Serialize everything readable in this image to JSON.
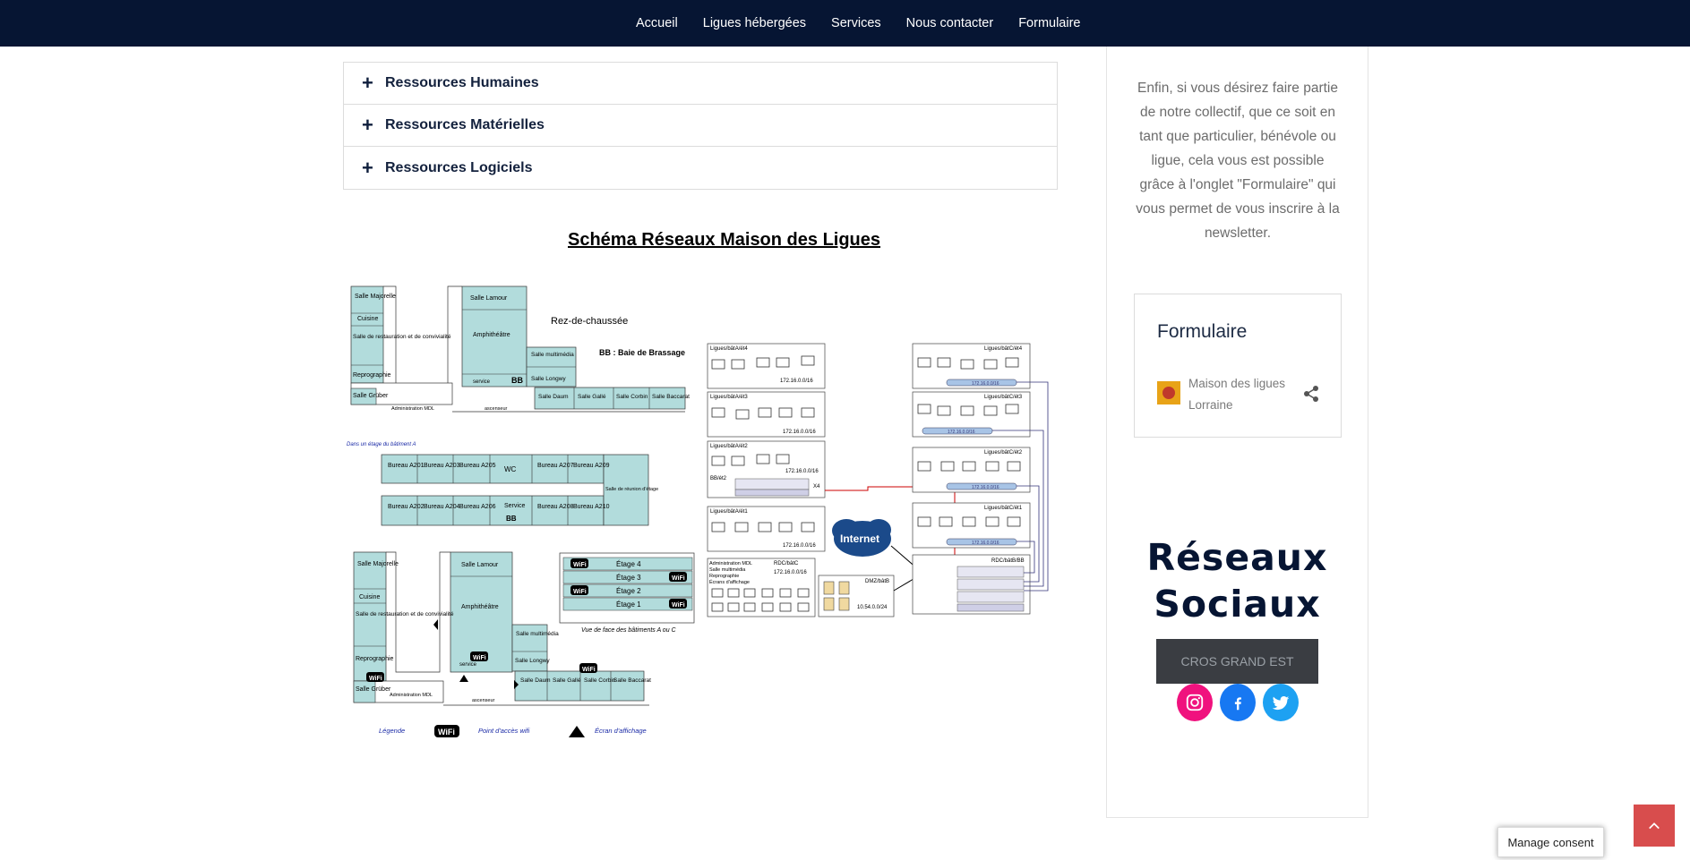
{
  "nav": {
    "items": [
      "Accueil",
      "Ligues hébergées",
      "Services",
      "Nous contacter",
      "Formulaire"
    ]
  },
  "accordion": {
    "items": [
      "Ressources Humaines",
      "Ressources Matérielles",
      "Ressources Logiciels"
    ]
  },
  "schema": {
    "title": "Schéma Réseaux Maison des Ligues",
    "floor_label": "Rez-de-chaussée",
    "bb_legend": "BB : Baie de Brassage",
    "upper_floor_note": "Dans un étage du bâtiment A",
    "rooms_ground": [
      "Salle Majorelle",
      "Cuisine",
      "Salle de restauration et de convivialité",
      "Reprographie",
      "Salle Grüber",
      "Administration MDL",
      "Salle Lamour",
      "Amphithéâtre",
      "service",
      "BB",
      "Salle multimédia",
      "Salle Longwy",
      "Salle Daum",
      "Salle Gallé",
      "Salle Corbin",
      "Salle Baccarat",
      "ascenseur"
    ],
    "offices": [
      "Bureau A201",
      "Bureau A203",
      "Bureau A205",
      "WC",
      "Bureau A207",
      "Bureau A209",
      "Bureau A202",
      "Bureau A204",
      "Bureau A206",
      "Service",
      "BB",
      "Bureau A208",
      "Bureau A210",
      "Salle de réunion d'étage"
    ],
    "floors": [
      "Étage 4",
      "Étage 3",
      "Étage 2",
      "Étage 1"
    ],
    "facade_caption": "Vue de face des bâtiments A ou C",
    "legend": {
      "title": "Légende",
      "wifi": "Point d'accès wifi",
      "screen": "Écran d'affichage"
    },
    "network_a": [
      {
        "label": "Ligues/bâtA/ét4",
        "ip": "172.16.0.0/16"
      },
      {
        "label": "Ligues/bâtA/ét3",
        "ip": "172.16.0.0/16"
      },
      {
        "label": "Ligues/bâtA/ét2",
        "ip": "172.16.0.0/16"
      },
      {
        "label": "Ligues/bâtA/ét1",
        "ip": "172.16.0.0/16"
      }
    ],
    "network_c": [
      {
        "label": "Ligues/bâtC/ét4",
        "ip": "172.16.0.0/16"
      },
      {
        "label": "Ligues/bâtC/ét3",
        "ip": "172.16.0.0/16"
      },
      {
        "label": "Ligues/bâtC/ét2",
        "ip": "172.16.0.0/16"
      },
      {
        "label": "Ligues/bâtC/ét1",
        "ip": "172.16.0.0/16"
      }
    ],
    "rdc": {
      "label": "RDC/bâtC",
      "ip": "172.16.0.0/16",
      "lines": [
        "Administration MDL",
        "Salle multimédia",
        "Reprographie",
        "Écrans d'affichage"
      ]
    },
    "dmz": {
      "label": "DMZ/bâtB",
      "ip": "10.54.0.0/24"
    },
    "bb_label": "BB/ét2",
    "x4": "X4",
    "internet": "Internet",
    "rdc_bb": "RDC/bâtB/BB"
  },
  "sidebar": {
    "text": "Enfin, si vous désirez faire partie de notre collectif, que ce soit en tant que particulier, bénévole ou ligue, cela vous est possible grâce à l'onglet \"Formulaire\" qui vous permet de vous inscrire à la newsletter.",
    "form_card": {
      "title": "Formulaire",
      "org": "Maison des ligues Lorraine"
    },
    "brand_line1": "Réseaux",
    "brand_line2": "Sociaux",
    "cros_button": "CROS GRAND EST",
    "social": [
      {
        "name": "instagram",
        "color": "#f0127e"
      },
      {
        "name": "facebook",
        "color": "#1778f2"
      },
      {
        "name": "twitter",
        "color": "#1da1f2"
      }
    ]
  },
  "consent": {
    "label": "Manage consent"
  },
  "colors": {
    "nav_bg": "#061533",
    "brand_text": "#061533",
    "room_fill": "#b2dcdc",
    "to_top": "#d84d4d"
  }
}
